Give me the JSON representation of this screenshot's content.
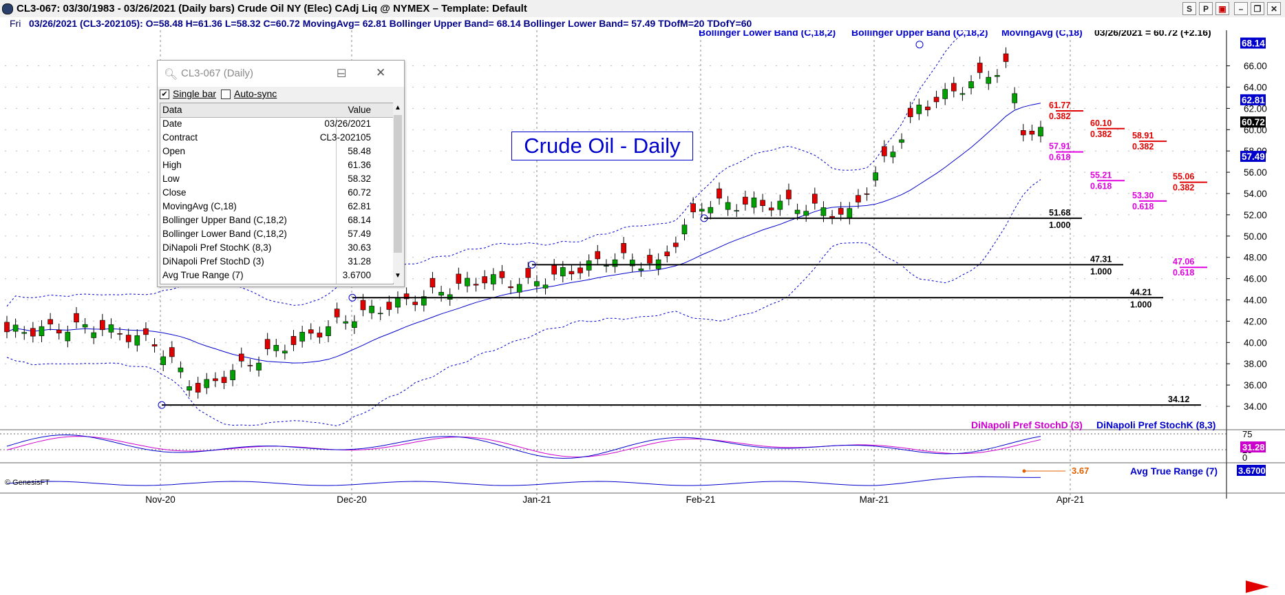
{
  "window": {
    "title": "CL3-067:  03/30/1983 - 03/26/2021  (Daily bars)   Crude Oil NY (Elec) CAdj Liq @ NYMEX  –  Template: Default",
    "buttons": [
      "S",
      "P",
      "▣",
      "–",
      "❐",
      "✕"
    ]
  },
  "infobar": {
    "day": "Fri",
    "quote": "03/26/2021 (CL3-202105):  O=58.48  H=61.36  L=58.32  C=60.72  MovingAvg= 62.81  Bollinger Upper Band= 68.14  Bollinger Lower Band= 57.49  TDofM=20  TDofY=60"
  },
  "chart_data": [
    {
      "type": "candlestick",
      "title": "Crude Oil - Daily",
      "series_labels": [
        "Bollinger Lower Band (C,18,2)",
        "Bollinger Upper Band (C,18,2)",
        "MovingAvg (C,18)"
      ],
      "last_label": "03/26/2021 = 60.72 (+2.16)",
      "ylim": [
        34,
        68
      ],
      "y_ticks": [
        "34.00",
        "36.00",
        "38.00",
        "40.00",
        "42.00",
        "44.00",
        "46.00",
        "48.00",
        "50.00",
        "52.00",
        "54.00",
        "56.00",
        "58.00",
        "60.00",
        "62.00",
        "64.00",
        "66.00"
      ],
      "x_ticks": [
        "Nov-20",
        "Dec-20",
        "Jan-21",
        "Feb-21",
        "Mar-21",
        "Apr-21"
      ],
      "price_tags": [
        {
          "text": "68.14",
          "value": 68.14,
          "color": "#0000cc"
        },
        {
          "text": "62.81",
          "value": 62.81,
          "color": "#0000cc"
        },
        {
          "text": "60.72",
          "value": 60.72,
          "color": "#000000"
        },
        {
          "text": "57.49",
          "value": 57.49,
          "color": "#0000cc"
        }
      ],
      "support_levels": [
        {
          "text": "51.68",
          "ratio": "1.000",
          "value": 51.68
        },
        {
          "text": "47.31",
          "ratio": "1.000",
          "value": 47.31
        },
        {
          "text": "44.21",
          "ratio": "1.000",
          "value": 44.21
        },
        {
          "text": "34.12",
          "ratio": "",
          "value": 34.12
        }
      ],
      "retracements": [
        {
          "text": "61.77",
          "ratio": "0.382",
          "value": 61.77,
          "color": "#e00000"
        },
        {
          "text": "57.91",
          "ratio": "0.618",
          "value": 57.91,
          "color": "#e000e0"
        },
        {
          "text": "60.10",
          "ratio": "0.382",
          "value": 60.1,
          "color": "#e00000"
        },
        {
          "text": "55.21",
          "ratio": "0.618",
          "value": 55.21,
          "color": "#e000e0"
        },
        {
          "text": "58.91",
          "ratio": "0.382",
          "value": 58.91,
          "color": "#e00000"
        },
        {
          "text": "53.30",
          "ratio": "0.618",
          "value": 53.3,
          "color": "#e000e0"
        },
        {
          "text": "55.06",
          "ratio": "0.382",
          "value": 55.06,
          "color": "#e00000"
        },
        {
          "text": "47.06",
          "ratio": "0.618",
          "value": 47.06,
          "color": "#e000e0"
        }
      ],
      "colors": {
        "up": "#00a000",
        "down": "#e00000",
        "bands": "#0000cc"
      }
    },
    {
      "type": "line",
      "legend": [
        "DiNapoli Pref StochD (3)",
        "DiNapoli Pref StochK (8,3)"
      ],
      "ylim": [
        0,
        100
      ],
      "y_ticks": [
        "75",
        "25",
        "0"
      ],
      "last_value": "31.28"
    },
    {
      "type": "line",
      "legend": [
        "Avg True Range (7)"
      ],
      "last_value": "3.6700",
      "annotation": "3.67"
    }
  ],
  "data_window": {
    "title": "CL3-067 (Daily)",
    "single_bar_label": "Single bar",
    "auto_sync_label": "Auto-sync",
    "header": {
      "key": "Data",
      "value": "Value"
    },
    "rows": [
      {
        "key": "Date",
        "value": "03/26/2021"
      },
      {
        "key": "Contract",
        "value": "CL3-202105"
      },
      {
        "key": "Open",
        "value": "58.48"
      },
      {
        "key": "High",
        "value": "61.36"
      },
      {
        "key": "Low",
        "value": "58.32"
      },
      {
        "key": "Close",
        "value": "60.72"
      },
      {
        "key": "MovingAvg (C,18)",
        "value": "62.81"
      },
      {
        "key": "Bollinger Upper Band (C,18,2)",
        "value": "68.14"
      },
      {
        "key": "Bollinger Lower Band (C,18,2)",
        "value": "57.49"
      },
      {
        "key": "DiNapoli Pref StochK (8,3)",
        "value": "30.63"
      },
      {
        "key": "DiNapoli Pref StochD (3)",
        "value": "31.28"
      },
      {
        "key": "Avg True Range (7)",
        "value": "3.6700"
      }
    ]
  },
  "copyright": "© GenesisFT"
}
